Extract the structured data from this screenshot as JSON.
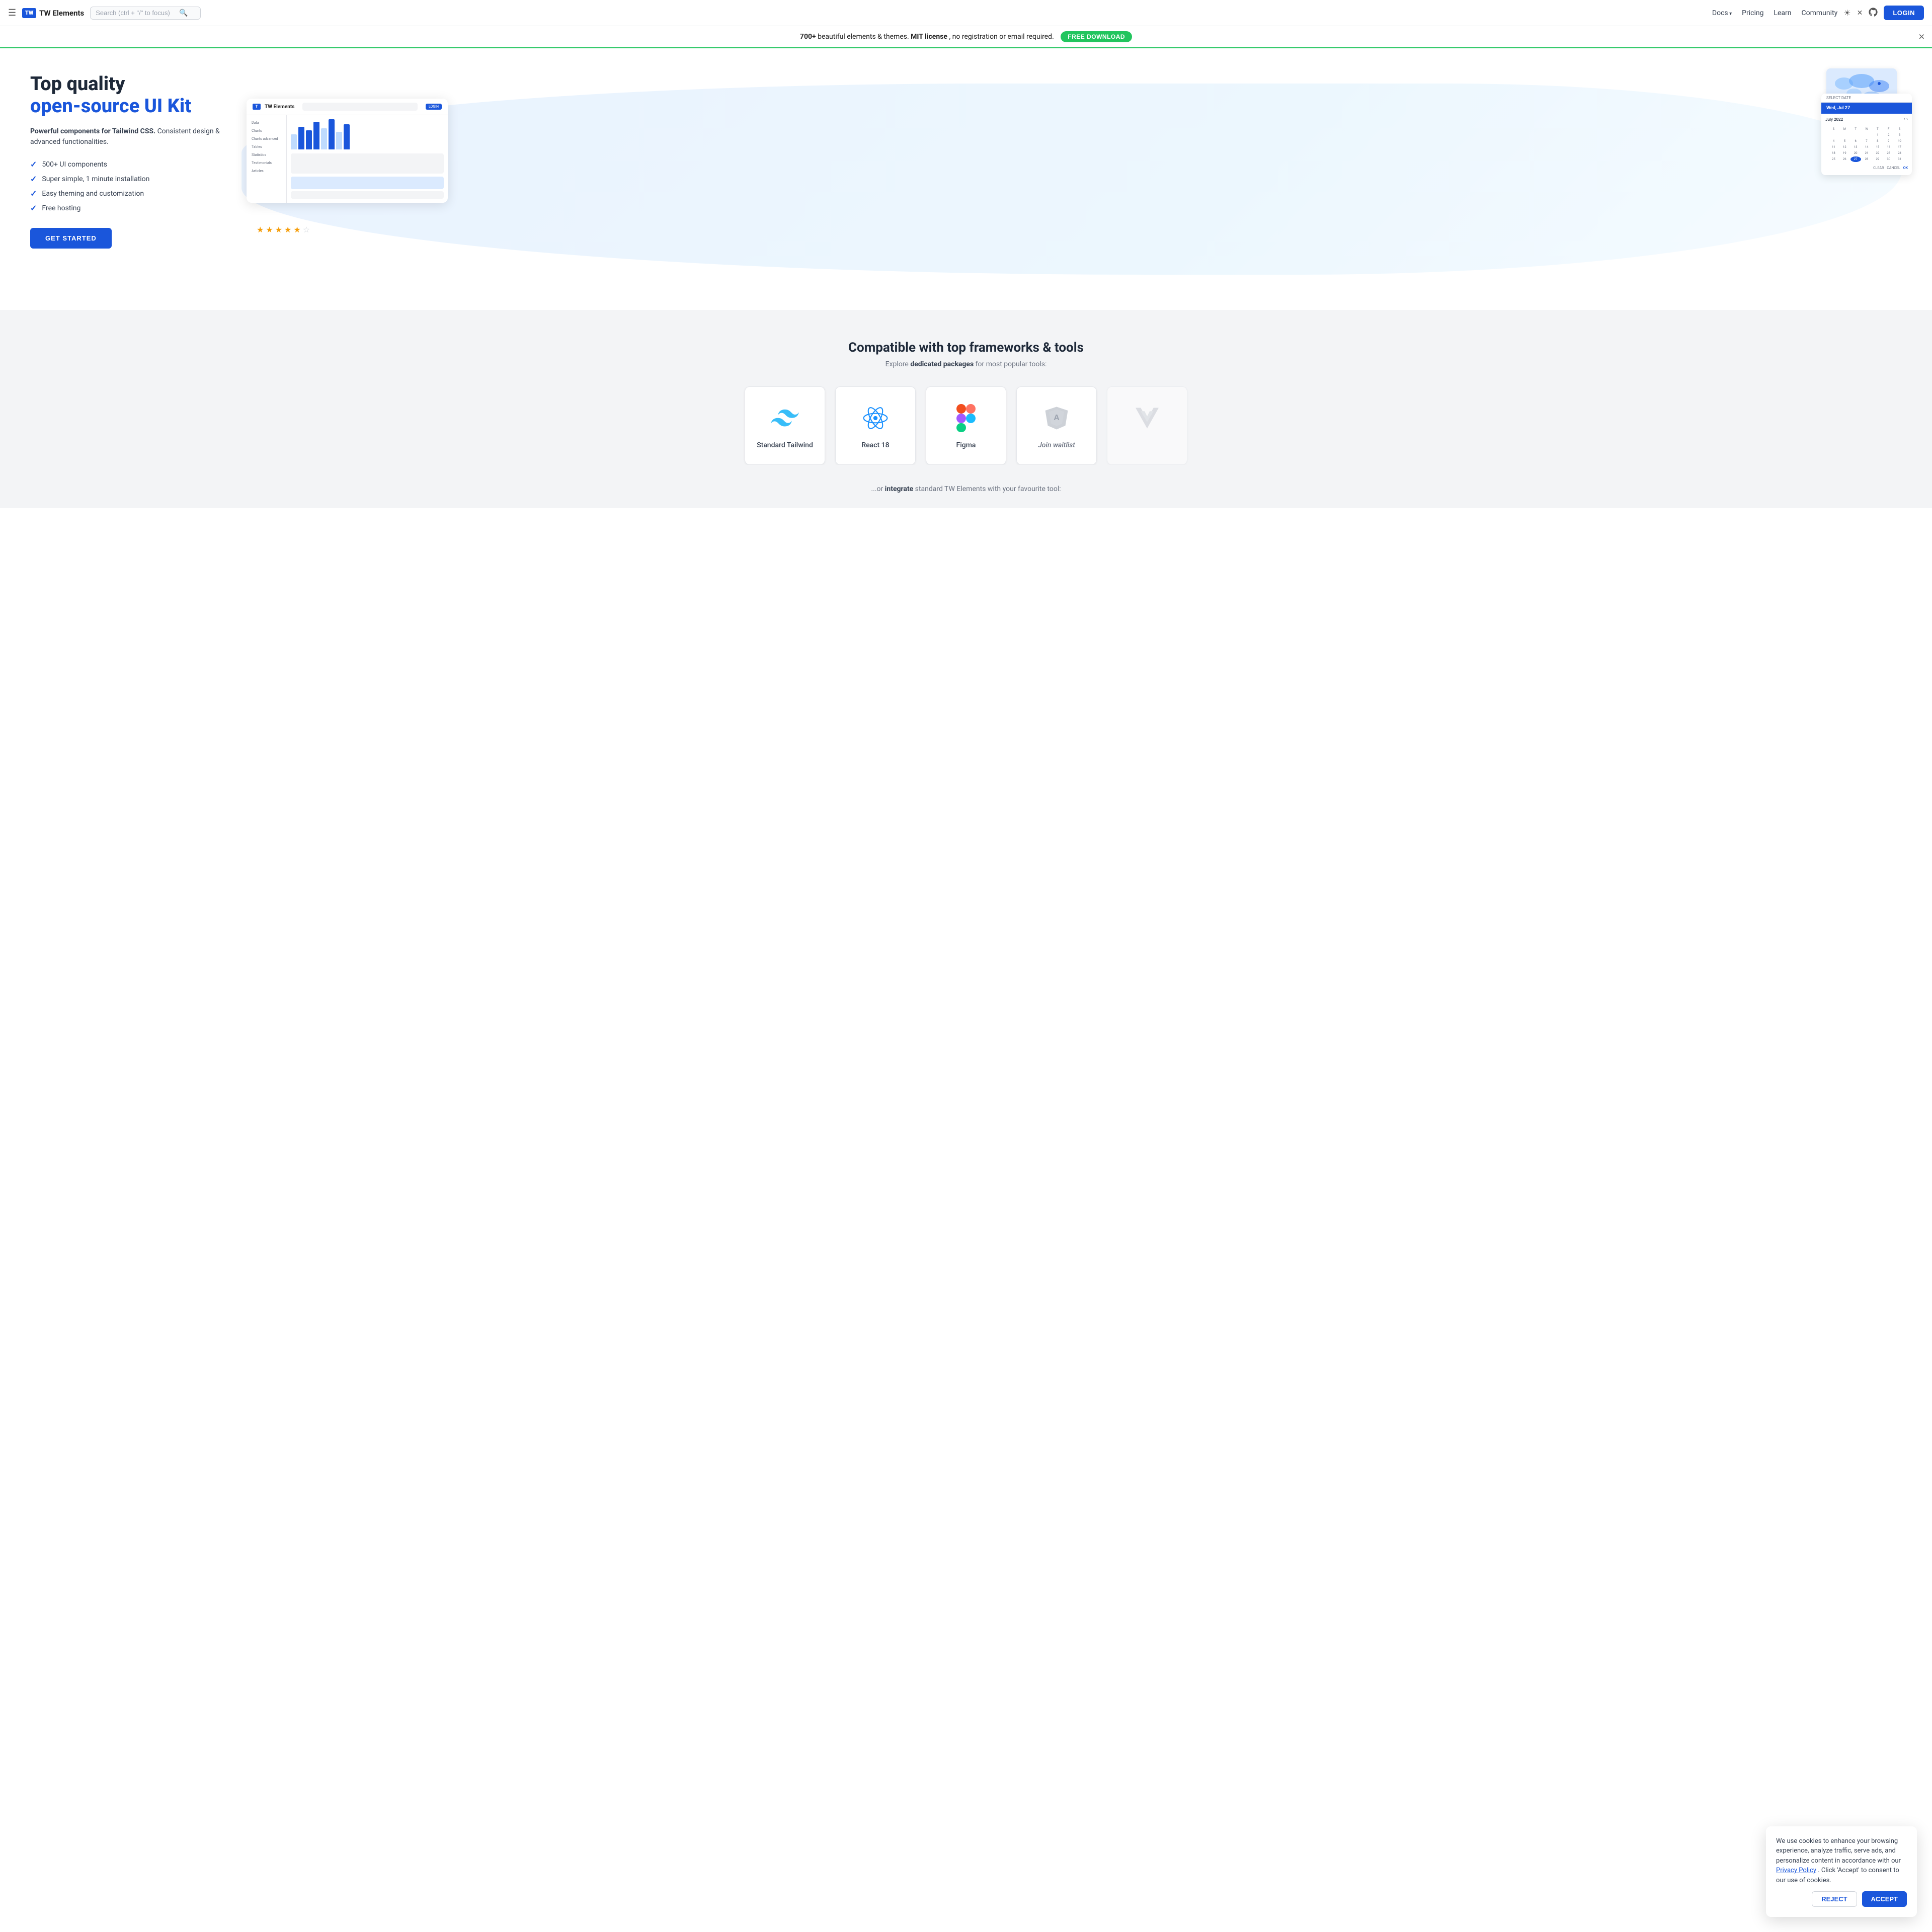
{
  "navbar": {
    "hamburger_label": "☰",
    "logo_text": "TW",
    "brand_name": "TW Elements",
    "search_placeholder": "Search (ctrl + \"/\" to focus)",
    "search_icon": "🔍",
    "docs_label": "Docs",
    "pricing_label": "Pricing",
    "learn_label": "Learn",
    "community_label": "Community",
    "theme_icon": "☀",
    "twitter_icon": "𝕏",
    "github_icon": "⌥",
    "login_label": "LOGIN"
  },
  "banner": {
    "text_bold": "700+",
    "text_normal": " beautiful elements & themes. ",
    "mit_text": "MIT license",
    "text2": ", no registration or email required.",
    "cta_label": "FREE DOWNLOAD",
    "close_icon": "✕"
  },
  "hero": {
    "title_line1": "Top quality",
    "title_line2": "open-source UI Kit",
    "subtitle": "Powerful components for Tailwind CSS. Consistent design & advanced functionalities.",
    "features": [
      "500+ UI components",
      "Super simple, 1 minute installation",
      "Easy theming and customization",
      "Free hosting"
    ],
    "cta_label": "GET STARTED"
  },
  "compatible": {
    "title": "Compatible with top frameworks & tools",
    "subtitle_prefix": "Explore ",
    "subtitle_bold": "dedicated packages",
    "subtitle_suffix": " for most popular tools:",
    "frameworks": [
      {
        "name": "Standard Tailwind",
        "icon": "tailwind",
        "italic": false
      },
      {
        "name": "React 18",
        "icon": "react",
        "italic": false
      },
      {
        "name": "Figma",
        "icon": "figma",
        "italic": false
      },
      {
        "name": "Join waitlist",
        "icon": "angular",
        "italic": true
      },
      {
        "name": "",
        "icon": "vue",
        "italic": true
      }
    ]
  },
  "integrate": {
    "text_prefix": "...or ",
    "text_bold": "integrate",
    "text_suffix": " standard TW Elements with your favourite tool:"
  },
  "cookie": {
    "text": "We use cookies to enhance your browsing experience, analyze traffic, serve ads, and personalize content in accordance with our ",
    "link_text": "Privacy Policy",
    "text2": ". Click 'Accept' to consent to our use of cookies.",
    "reject_label": "REJECT",
    "accept_label": "ACCEPT"
  },
  "mock": {
    "brand": "TW Elements",
    "login": "LOGIN",
    "sidebar_items": [
      "Data",
      "Charts",
      "Charts advanced",
      "Tables",
      "Statistics",
      "Testimonials",
      "Articles"
    ],
    "date_header": "Wed, Jul 27",
    "select_date": "SELECT DATE",
    "bars": [
      40,
      55,
      45,
      70,
      60,
      80,
      65,
      50
    ],
    "stars": [
      "★",
      "★",
      "★",
      "★",
      "★",
      "☆"
    ]
  }
}
